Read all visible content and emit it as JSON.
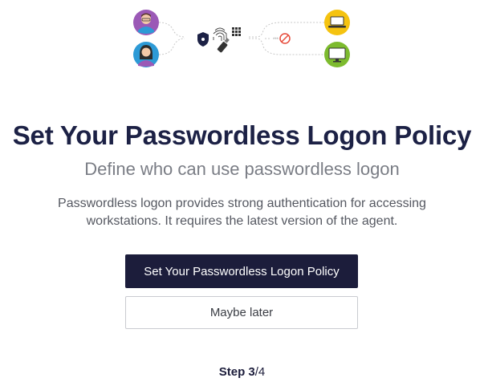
{
  "illustration": {
    "icons": [
      "user-male-icon",
      "user-female-icon",
      "shield-icon",
      "fingerprint-icon",
      "keypad-icon",
      "usb-key-icon",
      "no-password-icon",
      "laptop-icon",
      "monitor-icon"
    ],
    "colors": {
      "user_male_bg": "#9b59b6",
      "user_female_bg": "#2d9ad6",
      "laptop_bg": "#f5c310",
      "monitor_bg": "#7dbb2e",
      "no_password_red": "#e74c3c"
    }
  },
  "header": {
    "title": "Set Your Passwordless Logon Policy",
    "subtitle": "Define who can use passwordless logon"
  },
  "body": {
    "description": "Passwordless logon provides strong authentication for accessing workstations. It requires the latest version of the agent."
  },
  "actions": {
    "primary_label": "Set Your Passwordless Logon Policy",
    "secondary_label": "Maybe later"
  },
  "progress": {
    "current_step": "Step 3",
    "total": "/4"
  }
}
